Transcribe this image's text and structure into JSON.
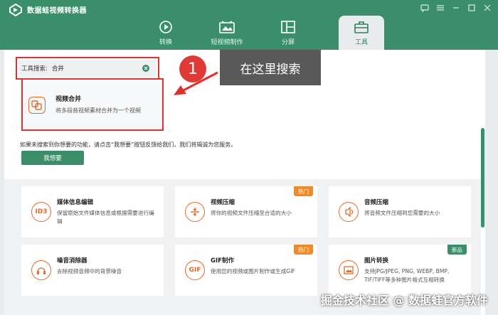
{
  "app": {
    "title": "数据蛙视频转换器"
  },
  "tabs": [
    {
      "label": "转换",
      "icon": "convert-icon"
    },
    {
      "label": "短视频制作",
      "icon": "short-video-icon"
    },
    {
      "label": "分屏",
      "icon": "split-screen-icon"
    },
    {
      "label": "工具",
      "icon": "toolbox-icon"
    }
  ],
  "active_tab": "工具",
  "search": {
    "label": "工具搜索:",
    "value": "合并"
  },
  "annotation": {
    "number": "1",
    "hint": "在这里搜索"
  },
  "result": {
    "title": "视频合并",
    "description": "将多段音视频素材合并为一个视频",
    "icon": "merge-icon"
  },
  "feedback": {
    "text": "如果未搜索到你想要的功能，请点击“我想要”按钮反馈给我们，我们将竭诚为您服务。",
    "button": "我想要"
  },
  "tools": [
    {
      "title": "媒体信息编辑",
      "description": "保留原始文件媒体信息或根据需要进行编辑",
      "icon_text": "ID3",
      "icon": "media-info-icon",
      "tag": ""
    },
    {
      "title": "视频压缩",
      "description": "将你的视频文件压缩至合适的大小",
      "icon_text": "",
      "icon": "video-compress-icon",
      "tag": "热门"
    },
    {
      "title": "音频压缩",
      "description": "将音频文件压缩到您需要的大小",
      "icon_text": "",
      "icon": "audio-compress-icon",
      "tag": ""
    },
    {
      "title": "噪音消除器",
      "description": "去除视频音频中的背景噪音",
      "icon_text": "",
      "icon": "noise-remover-icon",
      "tag": ""
    },
    {
      "title": "GIF制作",
      "description": "使用您的视频或图片制作或生成GIF",
      "icon_text": "GIF",
      "icon": "gif-icon",
      "tag": "热门"
    },
    {
      "title": "图片转换",
      "description": "支持JPG/JPEG, PNG, WEBP, BMP, TIF/TIFF等多种图片格式互相转换",
      "icon_text": "",
      "icon": "image-convert-icon",
      "tag": "新品"
    }
  ],
  "watermark": "掘金技术社区 @ 数据蛙官方软件",
  "colors": {
    "brand": "#3a8f6a",
    "accent": "#e06a2a",
    "hot": "#f08a24",
    "annotation_red": "#e0302c"
  }
}
